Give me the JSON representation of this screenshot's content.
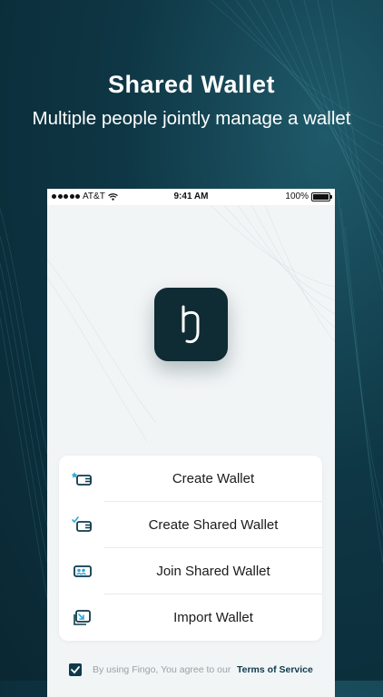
{
  "marketing": {
    "title": "Shared Wallet",
    "subtitle": "Multiple people jointly manage a wallet"
  },
  "status_bar": {
    "carrier": "AT&T",
    "time": "9:41 AM",
    "battery": "100%"
  },
  "app": {
    "logo_icon": "fingo-logo-icon",
    "brand_color": "#0f2b33"
  },
  "menu": {
    "items": [
      {
        "label": "Create Wallet",
        "icon": "create-wallet-icon"
      },
      {
        "label": "Create Shared Wallet",
        "icon": "create-shared-wallet-icon"
      },
      {
        "label": "Join Shared Wallet",
        "icon": "join-shared-wallet-icon"
      },
      {
        "label": "Import Wallet",
        "icon": "import-wallet-icon"
      }
    ]
  },
  "agreement": {
    "checked": true,
    "text": "By using Fingo, You agree to our",
    "link": "Terms of Service"
  },
  "colors": {
    "background": "#0e3644",
    "accent": "#0f3a4c",
    "star": "#2ea9d6"
  }
}
